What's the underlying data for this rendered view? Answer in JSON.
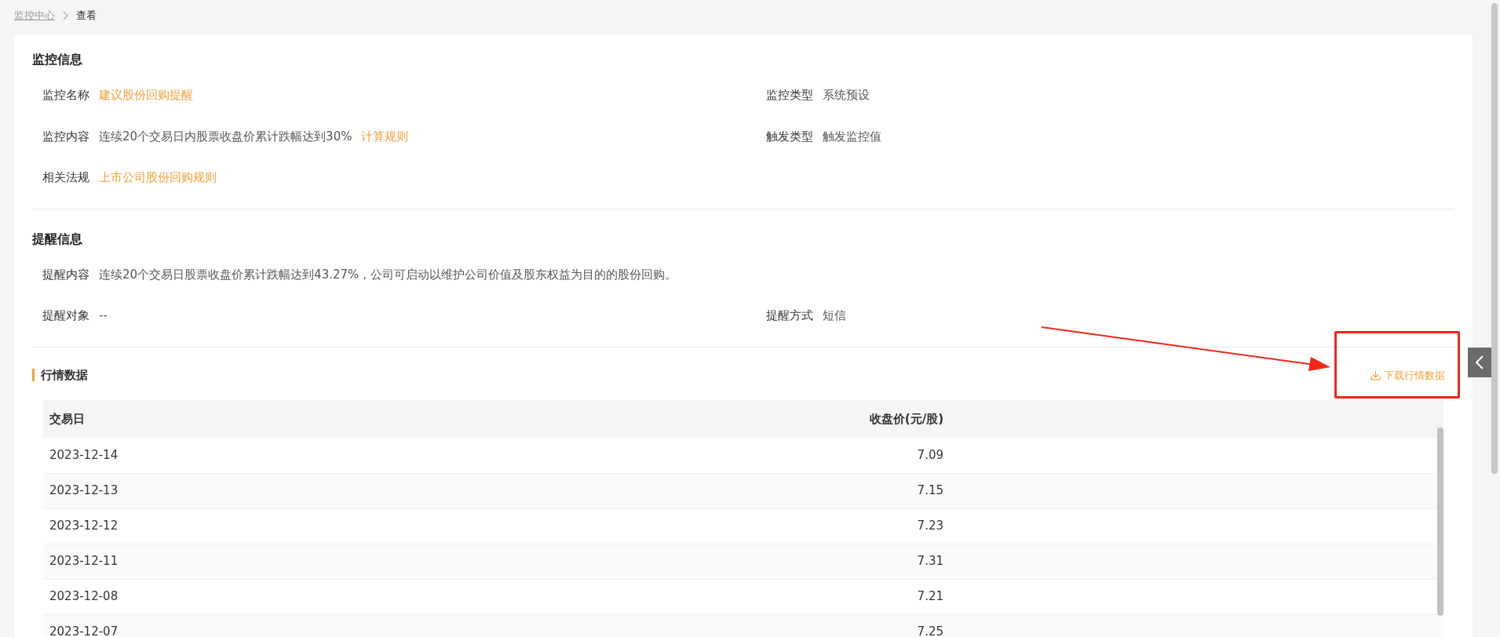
{
  "breadcrumb": [
    "监控中心",
    "查看"
  ],
  "sections": [
    {
      "title": "监控信息",
      "rows": [
        [
          {
            "label": "监控名称",
            "value": "建议股份回购提醒",
            "kind": "link"
          },
          {
            "label": "监控类型",
            "value": "系统预设",
            "kind": "text"
          }
        ],
        [
          {
            "label": "监控内容",
            "value": "连续20个交易日内股票收盘价累计跌幅达到30%",
            "link": "计算规则",
            "kind": "text"
          },
          {
            "label": "触发类型",
            "value": "触发监控值",
            "kind": "text"
          }
        ],
        [
          {
            "label": "相关法规",
            "value": "上市公司股份回购规则",
            "kind": "link"
          }
        ]
      ]
    },
    {
      "title": "提醒信息",
      "rows": [
        [
          {
            "label": "提醒内容",
            "value": "连续20个交易日股票收盘价累计跌幅达到43.27%，公司可启动以维护公司价值及股东权益为目的的股份回购。",
            "kind": "text"
          }
        ],
        [
          {
            "label": "提醒对象",
            "value": "--",
            "kind": "text"
          },
          {
            "label": "提醒方式",
            "value": "短信",
            "kind": "text"
          }
        ]
      ]
    }
  ],
  "market": {
    "title": "行情数据",
    "download": "下载行情数据",
    "table": {
      "columns": [
        "交易日",
        "收盘价(元/股)"
      ],
      "rows": [
        [
          "2023-12-14",
          "7.09"
        ],
        [
          "2023-12-13",
          "7.15"
        ],
        [
          "2023-12-12",
          "7.23"
        ],
        [
          "2023-12-11",
          "7.31"
        ],
        [
          "2023-12-08",
          "7.21"
        ],
        [
          "2023-12-07",
          "7.25"
        ]
      ]
    }
  }
}
